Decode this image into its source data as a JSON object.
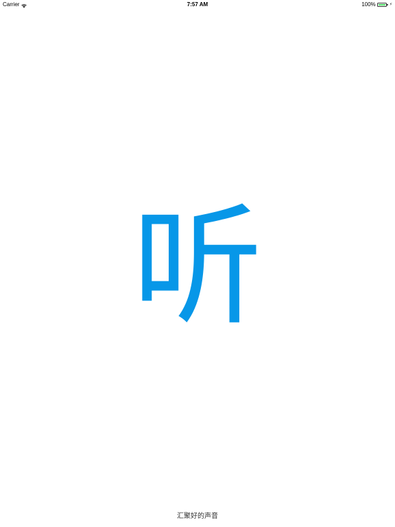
{
  "status_bar": {
    "carrier": "Carrier",
    "time": "7:57 AM",
    "battery_percent_label": "100%",
    "battery_level": 1.0,
    "icons": [
      "wifi-icon",
      "battery-icon",
      "charging-bolt-icon"
    ]
  },
  "splash": {
    "logo_char": "听",
    "tagline": "汇聚好的声音"
  },
  "colors": {
    "brand": "#0797e8",
    "battery_fill": "#4cd964"
  }
}
